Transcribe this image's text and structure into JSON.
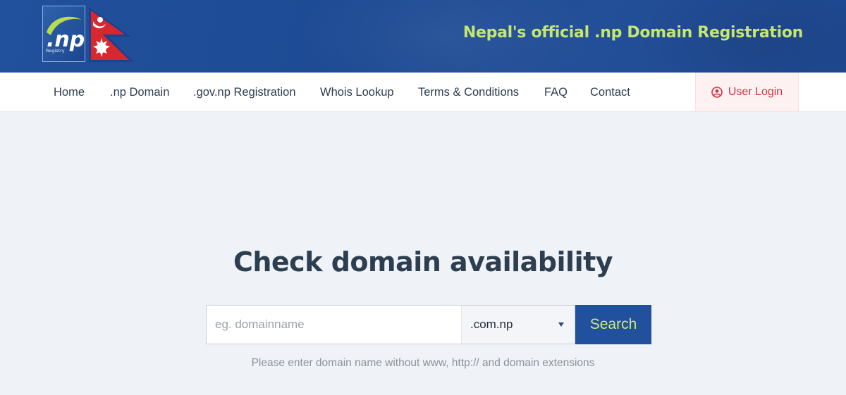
{
  "header": {
    "logo_text": ".np",
    "logo_subtext": "Registry",
    "site_title": "Nepal's official .np Domain Registration"
  },
  "nav": {
    "items": [
      {
        "label": "Home"
      },
      {
        "label": ".np Domain"
      },
      {
        "label": ".gov.np Registration"
      },
      {
        "label": "Whois Lookup"
      },
      {
        "label": "Terms & Conditions"
      },
      {
        "label": "FAQ"
      },
      {
        "label": "Contact"
      }
    ],
    "login": {
      "label": "User Login",
      "icon": "user-circle-icon"
    }
  },
  "main": {
    "heading": "Check domain availability",
    "search": {
      "placeholder": "eg. domainname",
      "value": "",
      "extension": ".com.np",
      "button_label": "Search"
    },
    "hint": "Please enter domain name without www, http:// and domain extensions"
  },
  "colors": {
    "header_blue": "#21509c",
    "title_green": "#c6e66e",
    "login_red": "#d2343f",
    "page_bg": "#eff3f7"
  }
}
